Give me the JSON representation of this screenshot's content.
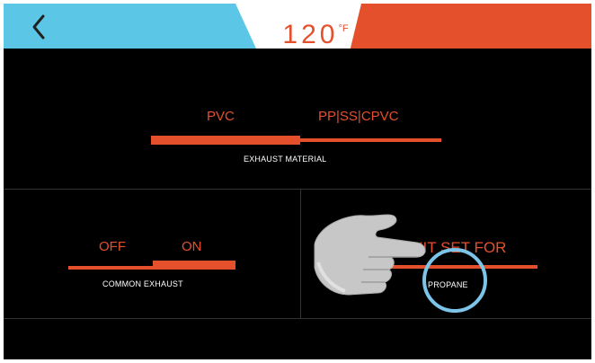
{
  "header": {
    "back_icon": "chevron-left-icon",
    "temperature_value": "120",
    "temperature_unit": "°F",
    "left_color": "#5cc6e6",
    "right_color": "#e4502c"
  },
  "exhaust_material": {
    "option_left": "PVC",
    "option_right": "PP|SS|CPVC",
    "caption": "EXHAUST MATERIAL"
  },
  "common_exhaust": {
    "option_off": "OFF",
    "option_on": "ON",
    "caption": "COMMON EXHAUST"
  },
  "unit_set_for": {
    "title": "UNIT SET FOR",
    "value": "PROPANE"
  },
  "overlay": {
    "icon": "pointing-hand-icon"
  },
  "colors": {
    "accent": "#e4502c",
    "highlight_ring": "#7cc4e8"
  }
}
